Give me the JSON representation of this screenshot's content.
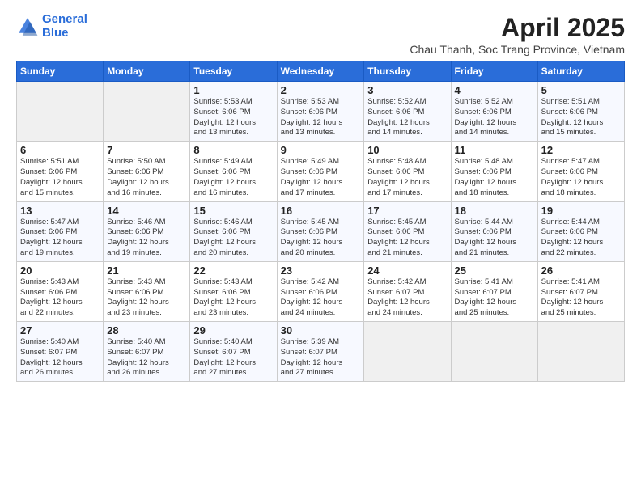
{
  "header": {
    "logo_line1": "General",
    "logo_line2": "Blue",
    "title": "April 2025",
    "subtitle": "Chau Thanh, Soc Trang Province, Vietnam"
  },
  "columns": [
    "Sunday",
    "Monday",
    "Tuesday",
    "Wednesday",
    "Thursday",
    "Friday",
    "Saturday"
  ],
  "weeks": [
    [
      {
        "num": "",
        "detail": ""
      },
      {
        "num": "",
        "detail": ""
      },
      {
        "num": "1",
        "detail": "Sunrise: 5:53 AM\nSunset: 6:06 PM\nDaylight: 12 hours\nand 13 minutes."
      },
      {
        "num": "2",
        "detail": "Sunrise: 5:53 AM\nSunset: 6:06 PM\nDaylight: 12 hours\nand 13 minutes."
      },
      {
        "num": "3",
        "detail": "Sunrise: 5:52 AM\nSunset: 6:06 PM\nDaylight: 12 hours\nand 14 minutes."
      },
      {
        "num": "4",
        "detail": "Sunrise: 5:52 AM\nSunset: 6:06 PM\nDaylight: 12 hours\nand 14 minutes."
      },
      {
        "num": "5",
        "detail": "Sunrise: 5:51 AM\nSunset: 6:06 PM\nDaylight: 12 hours\nand 15 minutes."
      }
    ],
    [
      {
        "num": "6",
        "detail": "Sunrise: 5:51 AM\nSunset: 6:06 PM\nDaylight: 12 hours\nand 15 minutes."
      },
      {
        "num": "7",
        "detail": "Sunrise: 5:50 AM\nSunset: 6:06 PM\nDaylight: 12 hours\nand 16 minutes."
      },
      {
        "num": "8",
        "detail": "Sunrise: 5:49 AM\nSunset: 6:06 PM\nDaylight: 12 hours\nand 16 minutes."
      },
      {
        "num": "9",
        "detail": "Sunrise: 5:49 AM\nSunset: 6:06 PM\nDaylight: 12 hours\nand 17 minutes."
      },
      {
        "num": "10",
        "detail": "Sunrise: 5:48 AM\nSunset: 6:06 PM\nDaylight: 12 hours\nand 17 minutes."
      },
      {
        "num": "11",
        "detail": "Sunrise: 5:48 AM\nSunset: 6:06 PM\nDaylight: 12 hours\nand 18 minutes."
      },
      {
        "num": "12",
        "detail": "Sunrise: 5:47 AM\nSunset: 6:06 PM\nDaylight: 12 hours\nand 18 minutes."
      }
    ],
    [
      {
        "num": "13",
        "detail": "Sunrise: 5:47 AM\nSunset: 6:06 PM\nDaylight: 12 hours\nand 19 minutes."
      },
      {
        "num": "14",
        "detail": "Sunrise: 5:46 AM\nSunset: 6:06 PM\nDaylight: 12 hours\nand 19 minutes."
      },
      {
        "num": "15",
        "detail": "Sunrise: 5:46 AM\nSunset: 6:06 PM\nDaylight: 12 hours\nand 20 minutes."
      },
      {
        "num": "16",
        "detail": "Sunrise: 5:45 AM\nSunset: 6:06 PM\nDaylight: 12 hours\nand 20 minutes."
      },
      {
        "num": "17",
        "detail": "Sunrise: 5:45 AM\nSunset: 6:06 PM\nDaylight: 12 hours\nand 21 minutes."
      },
      {
        "num": "18",
        "detail": "Sunrise: 5:44 AM\nSunset: 6:06 PM\nDaylight: 12 hours\nand 21 minutes."
      },
      {
        "num": "19",
        "detail": "Sunrise: 5:44 AM\nSunset: 6:06 PM\nDaylight: 12 hours\nand 22 minutes."
      }
    ],
    [
      {
        "num": "20",
        "detail": "Sunrise: 5:43 AM\nSunset: 6:06 PM\nDaylight: 12 hours\nand 22 minutes."
      },
      {
        "num": "21",
        "detail": "Sunrise: 5:43 AM\nSunset: 6:06 PM\nDaylight: 12 hours\nand 23 minutes."
      },
      {
        "num": "22",
        "detail": "Sunrise: 5:43 AM\nSunset: 6:06 PM\nDaylight: 12 hours\nand 23 minutes."
      },
      {
        "num": "23",
        "detail": "Sunrise: 5:42 AM\nSunset: 6:06 PM\nDaylight: 12 hours\nand 24 minutes."
      },
      {
        "num": "24",
        "detail": "Sunrise: 5:42 AM\nSunset: 6:07 PM\nDaylight: 12 hours\nand 24 minutes."
      },
      {
        "num": "25",
        "detail": "Sunrise: 5:41 AM\nSunset: 6:07 PM\nDaylight: 12 hours\nand 25 minutes."
      },
      {
        "num": "26",
        "detail": "Sunrise: 5:41 AM\nSunset: 6:07 PM\nDaylight: 12 hours\nand 25 minutes."
      }
    ],
    [
      {
        "num": "27",
        "detail": "Sunrise: 5:40 AM\nSunset: 6:07 PM\nDaylight: 12 hours\nand 26 minutes."
      },
      {
        "num": "28",
        "detail": "Sunrise: 5:40 AM\nSunset: 6:07 PM\nDaylight: 12 hours\nand 26 minutes."
      },
      {
        "num": "29",
        "detail": "Sunrise: 5:40 AM\nSunset: 6:07 PM\nDaylight: 12 hours\nand 27 minutes."
      },
      {
        "num": "30",
        "detail": "Sunrise: 5:39 AM\nSunset: 6:07 PM\nDaylight: 12 hours\nand 27 minutes."
      },
      {
        "num": "",
        "detail": ""
      },
      {
        "num": "",
        "detail": ""
      },
      {
        "num": "",
        "detail": ""
      }
    ]
  ]
}
